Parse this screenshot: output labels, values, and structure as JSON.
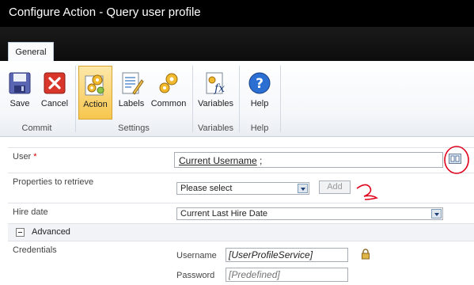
{
  "window": {
    "title": "Configure Action - Query user profile"
  },
  "tabs": [
    {
      "label": "General"
    }
  ],
  "ribbon": {
    "groups": [
      {
        "label": "Commit",
        "buttons": [
          {
            "label": "Save",
            "icon": "save-icon"
          },
          {
            "label": "Cancel",
            "icon": "cancel-icon"
          }
        ]
      },
      {
        "label": "Settings",
        "buttons": [
          {
            "label": "Action",
            "icon": "action-gears-icon",
            "active": true
          },
          {
            "label": "Labels",
            "icon": "labels-icon"
          },
          {
            "label": "Common",
            "icon": "common-gears-icon"
          }
        ]
      },
      {
        "label": "Variables",
        "buttons": [
          {
            "label": "Variables",
            "icon": "variables-fx-icon"
          }
        ]
      },
      {
        "label": "Help",
        "buttons": [
          {
            "label": "Help",
            "icon": "help-icon"
          }
        ]
      }
    ]
  },
  "form": {
    "user": {
      "label": "User",
      "required_mark": "*",
      "value": "Current Username",
      "suffix": " ;"
    },
    "properties": {
      "label": "Properties to retrieve",
      "selected": "Please select",
      "add_label": "Add"
    },
    "hire_date": {
      "label": "Hire date",
      "selected": "Current Last Hire Date"
    },
    "advanced": {
      "label": "Advanced"
    },
    "credentials": {
      "label": "Credentials",
      "username_label": "Username",
      "username_value": "[UserProfileService]",
      "password_label": "Password",
      "password_placeholder": "[Predefined]"
    }
  },
  "colors": {
    "annotation": "#e0001b",
    "active_button": "#f7c64e",
    "titlebar": "#000000"
  }
}
